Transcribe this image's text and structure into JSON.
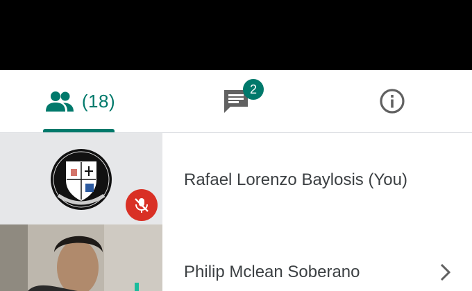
{
  "tabs": {
    "people": {
      "count_label": "(18)",
      "icon": "people-icon",
      "selected": true
    },
    "chat": {
      "badge": "2",
      "icon": "chat-icon"
    },
    "info": {
      "icon": "info-icon"
    }
  },
  "participants": [
    {
      "name": "Rafael Lorenzo Baylosis (You)",
      "muted": true,
      "thumbnail": "crest-logo"
    },
    {
      "name": "Philip Mclean Soberano",
      "muted": false,
      "thumbnail": "camera-video"
    }
  ],
  "colors": {
    "accent": "#00796b",
    "mic_off": "#d93025",
    "icon_gray": "#616161",
    "text": "#3c4043"
  }
}
